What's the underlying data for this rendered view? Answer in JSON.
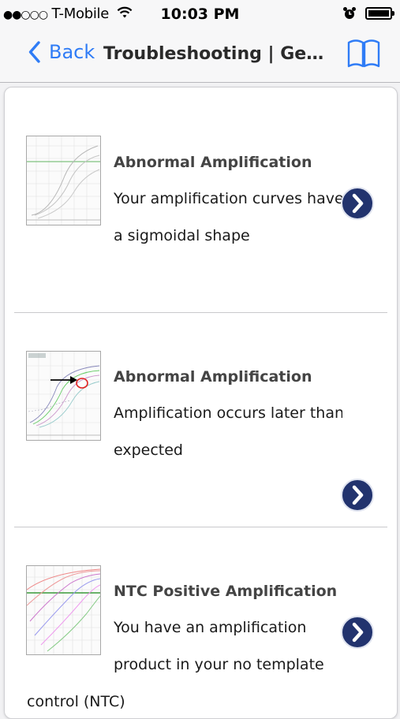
{
  "status_bar": {
    "signal": "●●○○○",
    "carrier": "T-Mobile",
    "time": "10:03 PM",
    "wifi_icon": "wifi-icon",
    "alarm_icon": "alarm-clock-icon",
    "battery_icon": "battery-icon"
  },
  "nav": {
    "back_label": "Back",
    "title": "Troubleshooting | General",
    "book_icon": "book-icon",
    "accent_color": "#2f7cf6"
  },
  "items": [
    {
      "title": "Abnormal Amplification",
      "line1": "Your amplification curves have",
      "line2": "a sigmoidal shape"
    },
    {
      "title": "Abnormal Amplification",
      "line1": "Amplification occurs later than",
      "line2": "expected"
    },
    {
      "title": "NTC Positive Amplification",
      "line1": "You have an amplification",
      "line2": "product in your no template control (NTC)"
    }
  ],
  "chevron_color": "#22336e"
}
